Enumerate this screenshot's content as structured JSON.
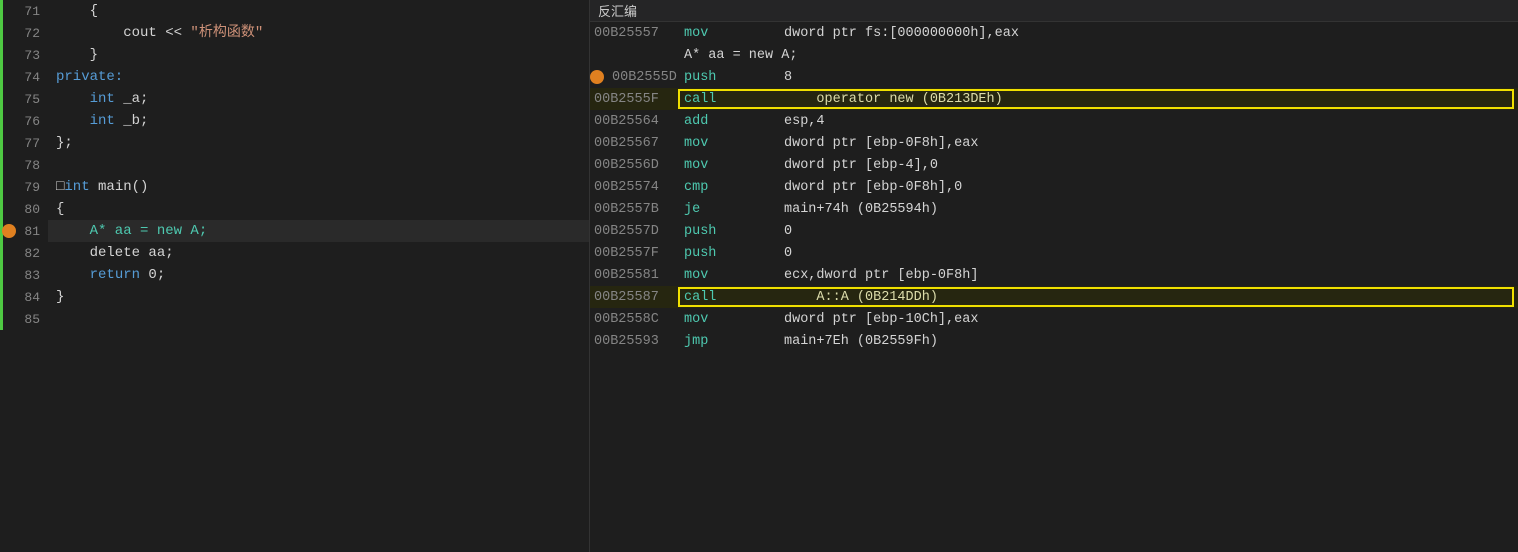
{
  "leftPane": {
    "lines": [
      {
        "num": "71",
        "indent": "    ",
        "tokens": [
          {
            "text": "    {",
            "class": "kw-white"
          }
        ],
        "greenBar": true
      },
      {
        "num": "72",
        "indent": "",
        "tokens": [
          {
            "text": "        cout << ",
            "class": "kw-white"
          },
          {
            "text": "\"析构函数\"",
            "class": "kw-string"
          }
        ],
        "greenBar": true
      },
      {
        "num": "73",
        "indent": "",
        "tokens": [
          {
            "text": "    }",
            "class": "kw-white"
          }
        ],
        "greenBar": true
      },
      {
        "num": "74",
        "indent": "",
        "tokens": [
          {
            "text": "private:",
            "class": "kw-blue"
          }
        ],
        "greenBar": true
      },
      {
        "num": "75",
        "indent": "",
        "tokens": [
          {
            "text": "    ",
            "class": "kw-white"
          },
          {
            "text": "int",
            "class": "kw-blue"
          },
          {
            "text": " _a;",
            "class": "kw-white"
          }
        ],
        "greenBar": true
      },
      {
        "num": "76",
        "indent": "",
        "tokens": [
          {
            "text": "    ",
            "class": "kw-white"
          },
          {
            "text": "int",
            "class": "kw-blue"
          },
          {
            "text": " _b;",
            "class": "kw-white"
          }
        ],
        "greenBar": true
      },
      {
        "num": "77",
        "indent": "",
        "tokens": [
          {
            "text": "};",
            "class": "kw-white"
          }
        ],
        "greenBar": true
      },
      {
        "num": "78",
        "indent": "",
        "tokens": [],
        "greenBar": true
      },
      {
        "num": "79",
        "indent": "",
        "tokens": [
          {
            "text": "□",
            "class": "kw-white"
          },
          {
            "text": "int",
            "class": "kw-blue"
          },
          {
            "text": " main()",
            "class": "kw-white"
          }
        ],
        "greenBar": true,
        "hasBox": true
      },
      {
        "num": "80",
        "indent": "",
        "tokens": [
          {
            "text": "{",
            "class": "kw-white"
          }
        ],
        "greenBar": true
      },
      {
        "num": "81",
        "indent": "",
        "tokens": [
          {
            "text": "    A* aa = new A;",
            "class": "kw-cyan"
          }
        ],
        "greenBar": true,
        "orangeDot": true,
        "highlighted": true
      },
      {
        "num": "82",
        "indent": "",
        "tokens": [
          {
            "text": "    delete aa;",
            "class": "kw-white"
          }
        ],
        "greenBar": true
      },
      {
        "num": "83",
        "indent": "",
        "tokens": [
          {
            "text": "    ",
            "class": "kw-white"
          },
          {
            "text": "return",
            "class": "kw-blue"
          },
          {
            "text": " 0;",
            "class": "kw-white"
          }
        ],
        "greenBar": true
      },
      {
        "num": "84",
        "indent": "",
        "tokens": [
          {
            "text": "}",
            "class": "kw-white"
          }
        ],
        "greenBar": true
      },
      {
        "num": "85",
        "indent": "",
        "tokens": [],
        "greenBar": true
      }
    ]
  },
  "rightPane": {
    "header": "反汇编",
    "rows": [
      {
        "type": "disasm",
        "addr": "00B25557",
        "mnemonic": "mov",
        "operands": "dword ptr fs:[000000000h],eax",
        "highlighted": false
      },
      {
        "type": "comment",
        "text": "    A* aa = new A;",
        "highlighted": false
      },
      {
        "type": "disasm",
        "addr": "00B2555D",
        "mnemonic": "push",
        "operands": "8",
        "highlighted": false,
        "orangeDot": true
      },
      {
        "type": "disasm",
        "addr": "00B2555F",
        "mnemonic": "call",
        "operands": "operator new (0B213DEh)",
        "highlighted": true,
        "callBox": true
      },
      {
        "type": "disasm",
        "addr": "00B25564",
        "mnemonic": "add",
        "operands": "esp,4",
        "highlighted": false
      },
      {
        "type": "disasm",
        "addr": "00B25567",
        "mnemonic": "mov",
        "operands": "dword ptr [ebp-0F8h],eax",
        "highlighted": false
      },
      {
        "type": "disasm",
        "addr": "00B2556D",
        "mnemonic": "mov",
        "operands": "dword ptr [ebp-4],0",
        "highlighted": false
      },
      {
        "type": "disasm",
        "addr": "00B25574",
        "mnemonic": "cmp",
        "operands": "dword ptr [ebp-0F8h],0",
        "highlighted": false
      },
      {
        "type": "disasm",
        "addr": "00B2557B",
        "mnemonic": "je",
        "operands": "main+74h (0B25594h)",
        "highlighted": false
      },
      {
        "type": "disasm",
        "addr": "00B2557D",
        "mnemonic": "push",
        "operands": "0",
        "highlighted": false
      },
      {
        "type": "disasm",
        "addr": "00B2557F",
        "mnemonic": "push",
        "operands": "0",
        "highlighted": false
      },
      {
        "type": "disasm",
        "addr": "00B25581",
        "mnemonic": "mov",
        "operands": "ecx,dword ptr [ebp-0F8h]",
        "highlighted": false
      },
      {
        "type": "disasm",
        "addr": "00B25587",
        "mnemonic": "call",
        "operands": "A::A (0B214DDh)",
        "highlighted": true,
        "callBox": true
      },
      {
        "type": "disasm",
        "addr": "00B2558C",
        "mnemonic": "mov",
        "operands": "dword ptr [ebp-10Ch],eax",
        "highlighted": false
      },
      {
        "type": "disasm",
        "addr": "00B25593",
        "mnemonic": "jmp",
        "operands": "main+7Eh (0B2559Fh)",
        "highlighted": false
      }
    ]
  }
}
